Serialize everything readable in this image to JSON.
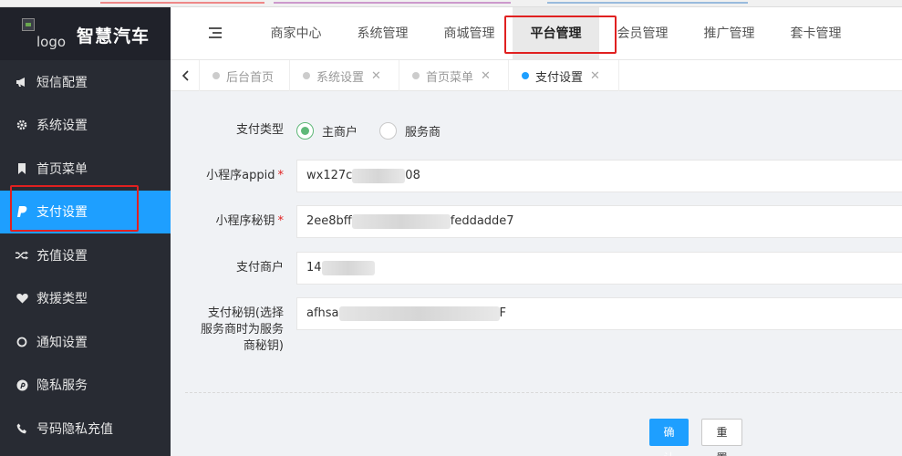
{
  "brand": {
    "logo_text": "logo",
    "name": "智慧汽车"
  },
  "header": {
    "nav": [
      "商家中心",
      "系统管理",
      "商城管理",
      "平台管理",
      "会员管理",
      "推广管理",
      "套卡管理"
    ],
    "active_nav": "平台管理"
  },
  "sidebar": {
    "items": [
      {
        "label": "短信配置",
        "icon": "megaphone-icon"
      },
      {
        "label": "系统设置",
        "icon": "gear-icon"
      },
      {
        "label": "首页菜单",
        "icon": "bookmark-icon"
      },
      {
        "label": "支付设置",
        "icon": "paypal-icon"
      },
      {
        "label": "充值设置",
        "icon": "shuffle-icon"
      },
      {
        "label": "救援类型",
        "icon": "heart-icon"
      },
      {
        "label": "通知设置",
        "icon": "circle-icon"
      },
      {
        "label": "隐私服务",
        "icon": "pinterest-icon"
      },
      {
        "label": "号码隐私充值",
        "icon": "phone-icon"
      }
    ],
    "active": "支付设置"
  },
  "tabs": [
    {
      "label": "后台首页",
      "closable": false
    },
    {
      "label": "系统设置",
      "closable": true
    },
    {
      "label": "首页菜单",
      "closable": true
    },
    {
      "label": "支付设置",
      "closable": true,
      "active": true
    }
  ],
  "form": {
    "pay_type": {
      "label": "支付类型",
      "options": [
        "主商户",
        "服务商"
      ],
      "selected": "主商户"
    },
    "appid": {
      "label": "小程序appid",
      "required": true,
      "value_start": "wx127c",
      "value_end": "08"
    },
    "secret": {
      "label": "小程序秘钥",
      "required": true,
      "value_start": "2ee8bff",
      "value_end": "feddadde7"
    },
    "merchant": {
      "label": "支付商户",
      "value_start": "14"
    },
    "pay_key": {
      "label": "支付秘钥(选择服务商时为服务商秘钥)",
      "label_lines": [
        "支付秘钥(选择",
        "服务商时为服务",
        "商秘钥)"
      ],
      "value_start": "afhsa",
      "value_end": "F"
    }
  },
  "buttons": {
    "confirm": "确认",
    "reset": "重置"
  },
  "colors": {
    "sidebar_bg": "#282b33",
    "active_blue": "#1e9fff",
    "radio_green": "#5fb878",
    "highlight_red": "#e02020"
  }
}
